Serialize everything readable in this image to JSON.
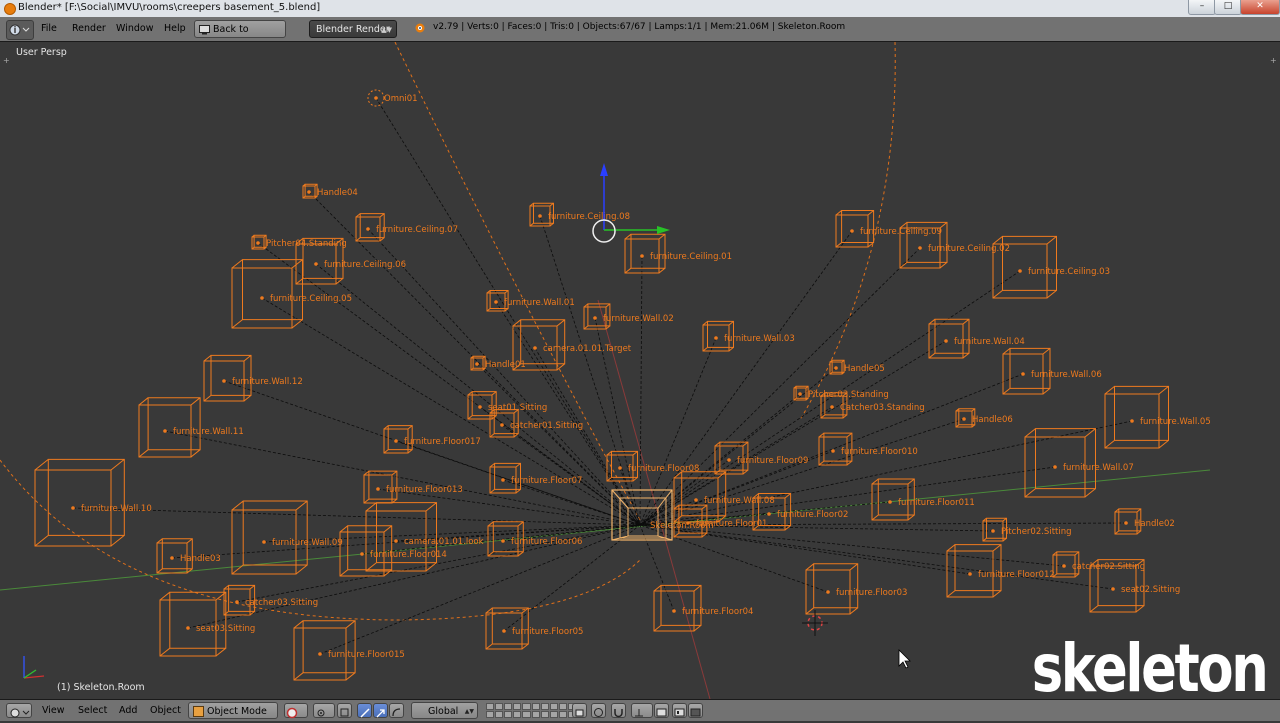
{
  "window": {
    "title": "Blender* [F:\\Social\\IMVU\\rooms\\creepers basement_5.blend]",
    "minimize": "–",
    "maximize": "□",
    "close": "✕"
  },
  "header": {
    "menus": [
      "File",
      "Render",
      "Window",
      "Help"
    ],
    "back_button": "Back to Previous",
    "render_engine": "Blender Render",
    "stats": "v2.79 | Verts:0 | Faces:0 | Tris:0 | Objects:67/67 | Lamps:1/1 | Mem:21.06M | Skeleton.Room"
  },
  "viewport": {
    "view_label": "User Persp",
    "selection_label": "(1) Skeleton.Room",
    "watermark": "skeleton",
    "accent_color": "#ee7a1e",
    "objects": [
      "Omni01",
      "Handle04",
      "furniture.Ceiling.07",
      "Pitcher04.Standing",
      "furniture.Ceiling.06",
      "furniture.Ceiling.05",
      "furniture.Ceiling.08",
      "furniture.Ceiling.01",
      "furniture.Ceiling.09",
      "furniture.Ceiling.02",
      "furniture.Ceiling.03",
      "furniture.Wall.01",
      "furniture.Wall.02",
      "furniture.Wall.03",
      "furniture.Wall.04",
      "furniture.Wall.06",
      "furniture.Wall.05",
      "furniture.Wall.07",
      "furniture.Wall.08",
      "furniture.Wall.09",
      "furniture.Wall.10",
      "furniture.Wall.11",
      "furniture.Wall.12",
      "camera.01.01.Target",
      "Handle01",
      "Handle02",
      "Handle03",
      "Handle05",
      "Handle06",
      "seat01.Sitting",
      "catcher01.Sitting",
      "Pitcher03.Standing",
      "Catcher03.Standing",
      "Pitcher02.Sitting",
      "catcher02.Sitting",
      "seat02.Sitting",
      "catcher03.Sitting",
      "seat03.Sitting",
      "furniture.Floor017",
      "furniture.Floor013",
      "furniture.Floor014",
      "furniture.Floor015",
      "furniture.Floor07",
      "furniture.Floor08",
      "furniture.Floor09",
      "furniture.Floor010",
      "furniture.Floor011",
      "furniture.Floor012",
      "furniture.Floor02",
      "furniture.Floor03",
      "furniture.Floor04",
      "furniture.Floor05",
      "furniture.Floor06",
      "furniture.Floor01",
      "camera.01.01.look",
      "Skeleton.Room"
    ]
  },
  "footer": {
    "menus": [
      "View",
      "Select",
      "Add",
      "Object"
    ],
    "mode": "Object Mode",
    "orientation": "Global"
  }
}
